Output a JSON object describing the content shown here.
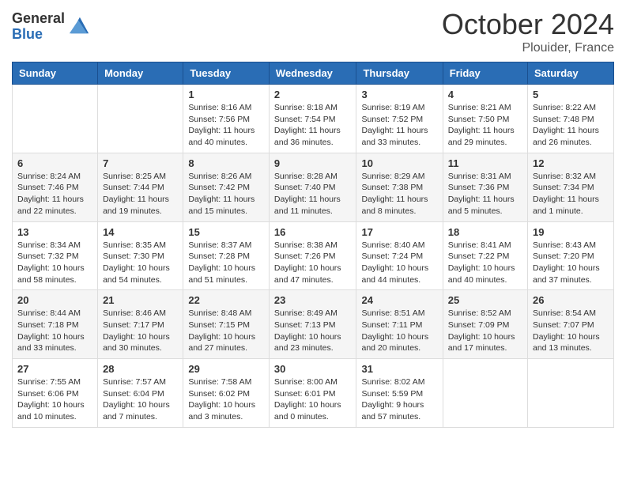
{
  "logo": {
    "general": "General",
    "blue": "Blue"
  },
  "header": {
    "month_year": "October 2024",
    "location": "Plouider, France"
  },
  "weekdays": [
    "Sunday",
    "Monday",
    "Tuesday",
    "Wednesday",
    "Thursday",
    "Friday",
    "Saturday"
  ],
  "weeks": [
    [
      null,
      null,
      {
        "day": "1",
        "sunrise": "Sunrise: 8:16 AM",
        "sunset": "Sunset: 7:56 PM",
        "daylight": "Daylight: 11 hours and 40 minutes."
      },
      {
        "day": "2",
        "sunrise": "Sunrise: 8:18 AM",
        "sunset": "Sunset: 7:54 PM",
        "daylight": "Daylight: 11 hours and 36 minutes."
      },
      {
        "day": "3",
        "sunrise": "Sunrise: 8:19 AM",
        "sunset": "Sunset: 7:52 PM",
        "daylight": "Daylight: 11 hours and 33 minutes."
      },
      {
        "day": "4",
        "sunrise": "Sunrise: 8:21 AM",
        "sunset": "Sunset: 7:50 PM",
        "daylight": "Daylight: 11 hours and 29 minutes."
      },
      {
        "day": "5",
        "sunrise": "Sunrise: 8:22 AM",
        "sunset": "Sunset: 7:48 PM",
        "daylight": "Daylight: 11 hours and 26 minutes."
      }
    ],
    [
      {
        "day": "6",
        "sunrise": "Sunrise: 8:24 AM",
        "sunset": "Sunset: 7:46 PM",
        "daylight": "Daylight: 11 hours and 22 minutes."
      },
      {
        "day": "7",
        "sunrise": "Sunrise: 8:25 AM",
        "sunset": "Sunset: 7:44 PM",
        "daylight": "Daylight: 11 hours and 19 minutes."
      },
      {
        "day": "8",
        "sunrise": "Sunrise: 8:26 AM",
        "sunset": "Sunset: 7:42 PM",
        "daylight": "Daylight: 11 hours and 15 minutes."
      },
      {
        "day": "9",
        "sunrise": "Sunrise: 8:28 AM",
        "sunset": "Sunset: 7:40 PM",
        "daylight": "Daylight: 11 hours and 11 minutes."
      },
      {
        "day": "10",
        "sunrise": "Sunrise: 8:29 AM",
        "sunset": "Sunset: 7:38 PM",
        "daylight": "Daylight: 11 hours and 8 minutes."
      },
      {
        "day": "11",
        "sunrise": "Sunrise: 8:31 AM",
        "sunset": "Sunset: 7:36 PM",
        "daylight": "Daylight: 11 hours and 5 minutes."
      },
      {
        "day": "12",
        "sunrise": "Sunrise: 8:32 AM",
        "sunset": "Sunset: 7:34 PM",
        "daylight": "Daylight: 11 hours and 1 minute."
      }
    ],
    [
      {
        "day": "13",
        "sunrise": "Sunrise: 8:34 AM",
        "sunset": "Sunset: 7:32 PM",
        "daylight": "Daylight: 10 hours and 58 minutes."
      },
      {
        "day": "14",
        "sunrise": "Sunrise: 8:35 AM",
        "sunset": "Sunset: 7:30 PM",
        "daylight": "Daylight: 10 hours and 54 minutes."
      },
      {
        "day": "15",
        "sunrise": "Sunrise: 8:37 AM",
        "sunset": "Sunset: 7:28 PM",
        "daylight": "Daylight: 10 hours and 51 minutes."
      },
      {
        "day": "16",
        "sunrise": "Sunrise: 8:38 AM",
        "sunset": "Sunset: 7:26 PM",
        "daylight": "Daylight: 10 hours and 47 minutes."
      },
      {
        "day": "17",
        "sunrise": "Sunrise: 8:40 AM",
        "sunset": "Sunset: 7:24 PM",
        "daylight": "Daylight: 10 hours and 44 minutes."
      },
      {
        "day": "18",
        "sunrise": "Sunrise: 8:41 AM",
        "sunset": "Sunset: 7:22 PM",
        "daylight": "Daylight: 10 hours and 40 minutes."
      },
      {
        "day": "19",
        "sunrise": "Sunrise: 8:43 AM",
        "sunset": "Sunset: 7:20 PM",
        "daylight": "Daylight: 10 hours and 37 minutes."
      }
    ],
    [
      {
        "day": "20",
        "sunrise": "Sunrise: 8:44 AM",
        "sunset": "Sunset: 7:18 PM",
        "daylight": "Daylight: 10 hours and 33 minutes."
      },
      {
        "day": "21",
        "sunrise": "Sunrise: 8:46 AM",
        "sunset": "Sunset: 7:17 PM",
        "daylight": "Daylight: 10 hours and 30 minutes."
      },
      {
        "day": "22",
        "sunrise": "Sunrise: 8:48 AM",
        "sunset": "Sunset: 7:15 PM",
        "daylight": "Daylight: 10 hours and 27 minutes."
      },
      {
        "day": "23",
        "sunrise": "Sunrise: 8:49 AM",
        "sunset": "Sunset: 7:13 PM",
        "daylight": "Daylight: 10 hours and 23 minutes."
      },
      {
        "day": "24",
        "sunrise": "Sunrise: 8:51 AM",
        "sunset": "Sunset: 7:11 PM",
        "daylight": "Daylight: 10 hours and 20 minutes."
      },
      {
        "day": "25",
        "sunrise": "Sunrise: 8:52 AM",
        "sunset": "Sunset: 7:09 PM",
        "daylight": "Daylight: 10 hours and 17 minutes."
      },
      {
        "day": "26",
        "sunrise": "Sunrise: 8:54 AM",
        "sunset": "Sunset: 7:07 PM",
        "daylight": "Daylight: 10 hours and 13 minutes."
      }
    ],
    [
      {
        "day": "27",
        "sunrise": "Sunrise: 7:55 AM",
        "sunset": "Sunset: 6:06 PM",
        "daylight": "Daylight: 10 hours and 10 minutes."
      },
      {
        "day": "28",
        "sunrise": "Sunrise: 7:57 AM",
        "sunset": "Sunset: 6:04 PM",
        "daylight": "Daylight: 10 hours and 7 minutes."
      },
      {
        "day": "29",
        "sunrise": "Sunrise: 7:58 AM",
        "sunset": "Sunset: 6:02 PM",
        "daylight": "Daylight: 10 hours and 3 minutes."
      },
      {
        "day": "30",
        "sunrise": "Sunrise: 8:00 AM",
        "sunset": "Sunset: 6:01 PM",
        "daylight": "Daylight: 10 hours and 0 minutes."
      },
      {
        "day": "31",
        "sunrise": "Sunrise: 8:02 AM",
        "sunset": "Sunset: 5:59 PM",
        "daylight": "Daylight: 9 hours and 57 minutes."
      },
      null,
      null
    ]
  ]
}
